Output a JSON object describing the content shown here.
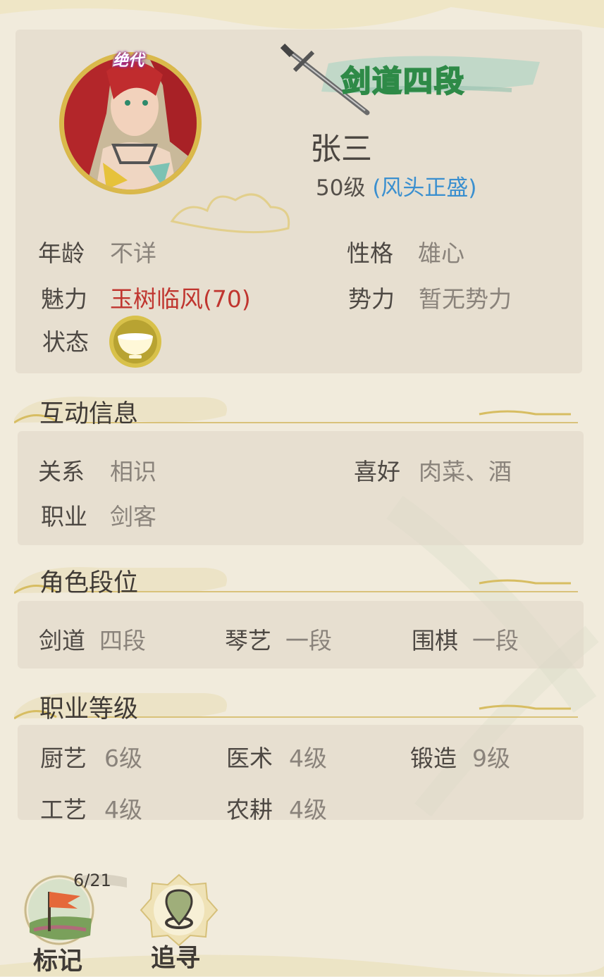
{
  "header": {
    "rarity": "绝代",
    "rank_title": "剑道四段",
    "name": "张三",
    "level": "50级",
    "fame": "(风头正盛)"
  },
  "basic": {
    "age_label": "年龄",
    "age_value": "不详",
    "personality_label": "性格",
    "personality_value": "雄心",
    "charm_label": "魅力",
    "charm_value": "玉树临风(70)",
    "faction_label": "势力",
    "faction_value": "暂无势力",
    "status_label": "状态",
    "status_icon": "bowl-icon"
  },
  "interaction": {
    "title": "互动信息",
    "relation_label": "关系",
    "relation_value": "相识",
    "hobby_label": "喜好",
    "hobby_value": "肉菜、酒",
    "job_label": "职业",
    "job_value": "剑客"
  },
  "ranks": {
    "title": "角色段位",
    "items": [
      {
        "label": "剑道",
        "value": "四段"
      },
      {
        "label": "琴艺",
        "value": "一段"
      },
      {
        "label": "围棋",
        "value": "一段"
      }
    ]
  },
  "jobs": {
    "title": "职业等级",
    "items": [
      {
        "label": "厨艺",
        "value": "6级"
      },
      {
        "label": "医术",
        "value": "4级"
      },
      {
        "label": "锻造",
        "value": "9级"
      },
      {
        "label": "工艺",
        "value": "4级"
      },
      {
        "label": "农耕",
        "value": "4级"
      }
    ]
  },
  "buttons": {
    "mark_label": "标记",
    "mark_count": "6/21",
    "track_label": "追寻"
  },
  "colors": {
    "background": "#f1ebdc",
    "fame_blue": "#3a8fcf",
    "charm_red": "#c0352f",
    "rank_green": "#2e8a47",
    "gold": "#d9b84a"
  }
}
